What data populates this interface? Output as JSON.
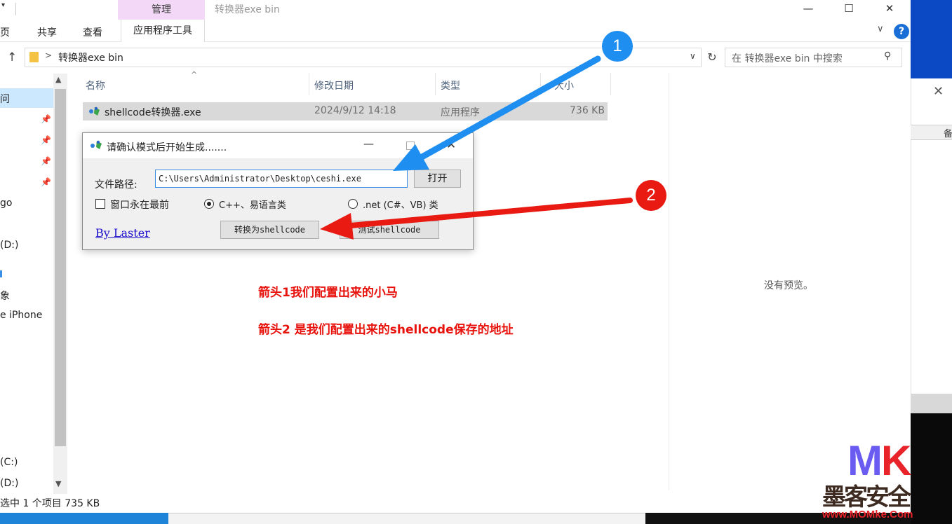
{
  "window": {
    "title": "转换器exe  bin",
    "manage_tab": "管理",
    "minimize": "—",
    "maximize": "☐",
    "close": "✕"
  },
  "ribbon": {
    "tabs": [
      "页",
      "共享",
      "查看"
    ],
    "tool_tab": "应用程序工具",
    "help": "?",
    "expand": "∨"
  },
  "address": {
    "up": "↑",
    "separator": ">",
    "path": "转换器exe  bin",
    "dropdown": "∨",
    "refresh": "↻",
    "search_placeholder": "在 转换器exe  bin 中搜索",
    "search_icon": "⚲"
  },
  "nav": {
    "items": [
      "问",
      "go",
      "(D:)",
      "象",
      "e iPhone",
      "(C:)",
      "(D:)"
    ],
    "scroll_up": "▲",
    "scroll_down": "▼",
    "pin": "📌"
  },
  "columns": {
    "name": "名称",
    "modified": "修改日期",
    "type": "类型",
    "size": "大小",
    "sort": "^"
  },
  "files": [
    {
      "name": "shellcode转换器.exe",
      "modified": "2024/9/12 14:18",
      "type": "应用程序",
      "size": "736 KB"
    }
  ],
  "preview": {
    "empty": "没有预览。"
  },
  "status": {
    "text": "选中 1 个项目  735 KB"
  },
  "dialog": {
    "title": "请确认模式后开始生成.......",
    "minimize": "—",
    "close": "✕",
    "path_label": "文件路径:",
    "path_value": "C:\\Users\\Administrator\\Desktop\\ceshi.exe",
    "open_button": "打开",
    "checkbox_label": "窗口永在最前",
    "radio_cpp": "C++、易语言类",
    "radio_net": ".net (C#、VB) 类",
    "link": "By Laster",
    "convert_button": "转换为shellcode",
    "test_button": "测试shellcode"
  },
  "annotations": {
    "badge_1": "1",
    "badge_2": "2",
    "note_1": "箭头1我们配置出来的小马",
    "note_2": "箭头2 是我们配置出来的shellcode保存的地址"
  },
  "desktop": {
    "panel_close": "✕",
    "panel_char": "备"
  },
  "watermark": {
    "m": "M",
    "k": "K",
    "cn": "墨客安全",
    "url": "www.MOMke.Com"
  },
  "colors": {
    "accent_blue": "#1e8ef0",
    "accent_red": "#e81a12",
    "selection": "#d9d9d9",
    "manage_tab": "#f3d9f7"
  }
}
